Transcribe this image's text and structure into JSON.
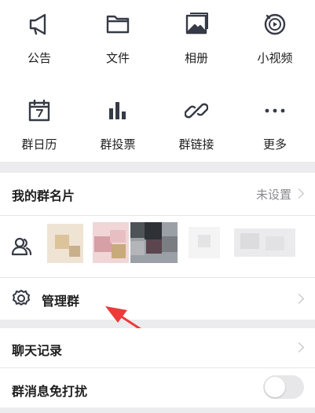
{
  "grid": {
    "items": [
      {
        "label": "公告",
        "icon": "megaphone-icon"
      },
      {
        "label": "文件",
        "icon": "folder-icon"
      },
      {
        "label": "相册",
        "icon": "photo-album-icon"
      },
      {
        "label": "小视频",
        "icon": "short-video-icon"
      },
      {
        "label": "群日历",
        "icon": "calendar-icon"
      },
      {
        "label": "群投票",
        "icon": "bar-chart-icon"
      },
      {
        "label": "群链接",
        "icon": "link-icon"
      },
      {
        "label": "更多",
        "icon": "more-dots-icon"
      }
    ]
  },
  "card": {
    "label": "我的群名片",
    "value": "未设置"
  },
  "members": {
    "icon": "members-icon"
  },
  "manage": {
    "label": "管理群"
  },
  "history": {
    "label": "聊天记录"
  },
  "mute": {
    "label": "群消息免打扰",
    "on": false
  },
  "colors": {
    "icon": "#363a46",
    "arrow": "#ee3a3a",
    "value": "#8a8a90",
    "background": "#ececee"
  }
}
